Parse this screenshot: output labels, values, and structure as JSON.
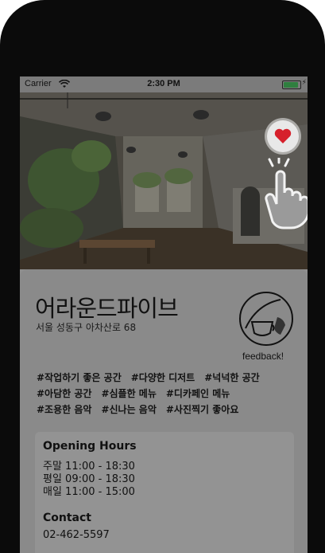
{
  "status_bar": {
    "carrier": "Carrier",
    "time": "2:30 PM"
  },
  "place": {
    "name": "어라운드파이브",
    "address": "서울 성동구 아차산로 68",
    "feedback_label": "feedback!",
    "tags_rows": [
      [
        "#작업하기 좋은 공간",
        "#다양한 디저트",
        "#넉넉한 공간"
      ],
      [
        "#아담한 공간",
        "#심플한 메뉴",
        "#디카페인 메뉴"
      ],
      [
        "#조용한 음악",
        "#신나는 음악",
        "#사진찍기 좋아요"
      ]
    ]
  },
  "info": {
    "opening_title": "Opening Hours",
    "hours": [
      "주말 11:00 - 18:30",
      "평일 09:00 - 18:30",
      "매일 11:00 - 15:00"
    ],
    "contact_title": "Contact",
    "phone": "02-462-5597"
  },
  "colors": {
    "heart": "#d6202b",
    "overlay": "#8e8e8e"
  }
}
